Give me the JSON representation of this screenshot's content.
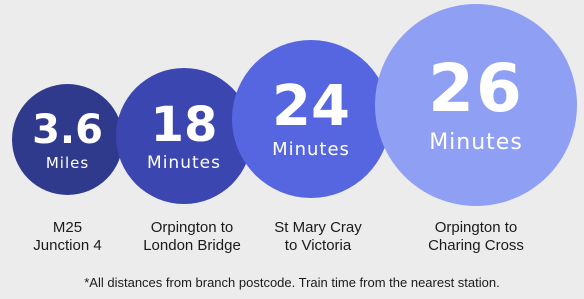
{
  "colors": {
    "background": "#ececec",
    "circle_1": "#303a8c",
    "circle_2": "#3b46b0",
    "circle_3": "#5566e0",
    "circle_4": "#8f9ff4",
    "text_dark": "#1a1a1a",
    "text_light": "#ffffff"
  },
  "stats": [
    {
      "value": "3.6",
      "unit": "Miles",
      "label_line1": "M25",
      "label_line2": "Junction 4"
    },
    {
      "value": "18",
      "unit": "Minutes",
      "label_line1": "Orpington to",
      "label_line2": "London Bridge"
    },
    {
      "value": "24",
      "unit": "Minutes",
      "label_line1": "St Mary Cray",
      "label_line2": "to Victoria"
    },
    {
      "value": "26",
      "unit": "Minutes",
      "label_line1": "Orpington to",
      "label_line2": "Charing Cross"
    }
  ],
  "footnote": "*All distances from branch postcode. Train time from the nearest station."
}
